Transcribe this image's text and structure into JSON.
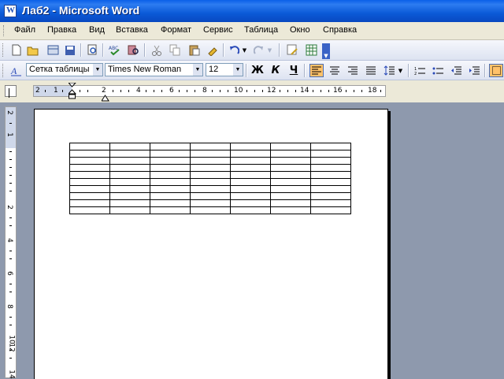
{
  "window": {
    "title": "Лаб2 - Microsoft Word"
  },
  "menu": [
    "Файл",
    "Правка",
    "Вид",
    "Вставка",
    "Формат",
    "Сервис",
    "Таблица",
    "Окно",
    "Справка"
  ],
  "formatting": {
    "style": "Сетка таблицы",
    "font": "Times New Roman",
    "size": "12",
    "bold": "Ж",
    "italic": "К",
    "underline": "Ч"
  },
  "ruler": {
    "horizontal_labels": [
      "2",
      "1",
      "2",
      "4",
      "6",
      "8",
      "10",
      "12",
      "14",
      "16",
      "18"
    ],
    "vertical_labels": [
      "2",
      "1",
      "2",
      "4",
      "6",
      "8",
      "10",
      "12",
      "14"
    ]
  },
  "document": {
    "table": {
      "rows": 10,
      "cols": 7
    }
  }
}
